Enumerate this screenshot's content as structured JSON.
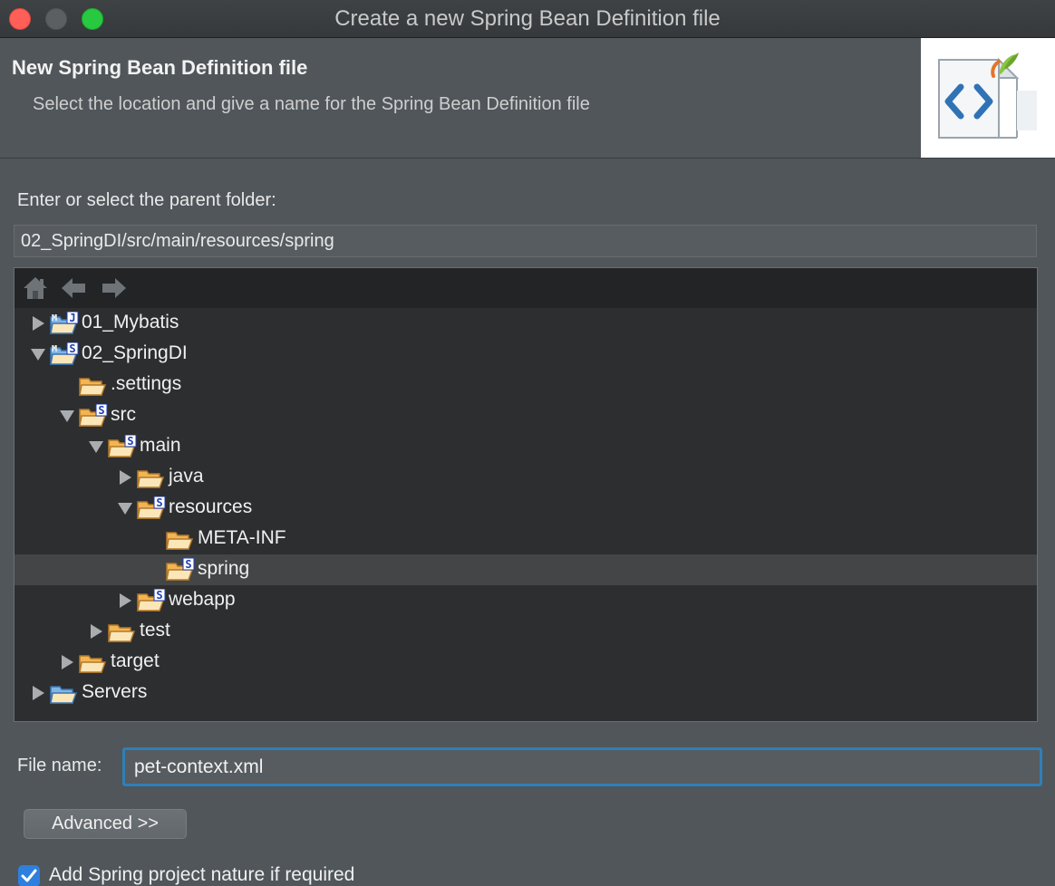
{
  "window": {
    "title": "Create a new Spring Bean Definition file"
  },
  "header": {
    "title": "New Spring Bean Definition file",
    "description": "Select the location and give a name for the Spring Bean Definition file",
    "image_icon": "spring-xml-file-icon"
  },
  "parent_folder": {
    "label": "Enter or select the parent folder:",
    "value": "02_SpringDI/src/main/resources/spring"
  },
  "tree": {
    "toolbar": [
      "home-icon",
      "back-arrow-icon",
      "forward-arrow-icon"
    ],
    "items": [
      {
        "label": "01_Mybatis",
        "depth": 0,
        "twisty": "collapsed",
        "icon": "project-folder-icon",
        "badge": "MJ",
        "selected": false
      },
      {
        "label": "02_SpringDI",
        "depth": 0,
        "twisty": "expanded",
        "icon": "project-folder-icon",
        "badge": "MS",
        "selected": false
      },
      {
        "label": ".settings",
        "depth": 1,
        "twisty": "none",
        "icon": "folder-icon",
        "badge": "",
        "selected": false
      },
      {
        "label": "src",
        "depth": 1,
        "twisty": "expanded",
        "icon": "folder-icon",
        "badge": "S",
        "selected": false
      },
      {
        "label": "main",
        "depth": 2,
        "twisty": "expanded",
        "icon": "folder-icon",
        "badge": "S",
        "selected": false
      },
      {
        "label": "java",
        "depth": 3,
        "twisty": "collapsed",
        "icon": "folder-icon",
        "badge": "",
        "selected": false
      },
      {
        "label": "resources",
        "depth": 3,
        "twisty": "expanded",
        "icon": "folder-icon",
        "badge": "S",
        "selected": false
      },
      {
        "label": "META-INF",
        "depth": 4,
        "twisty": "none",
        "icon": "folder-icon",
        "badge": "",
        "selected": false
      },
      {
        "label": "spring",
        "depth": 4,
        "twisty": "none",
        "icon": "folder-icon",
        "badge": "S",
        "selected": true
      },
      {
        "label": "webapp",
        "depth": 3,
        "twisty": "collapsed",
        "icon": "folder-icon",
        "badge": "S",
        "selected": false
      },
      {
        "label": "test",
        "depth": 2,
        "twisty": "collapsed",
        "icon": "folder-icon",
        "badge": "",
        "selected": false
      },
      {
        "label": "target",
        "depth": 1,
        "twisty": "collapsed",
        "icon": "folder-icon",
        "badge": "",
        "selected": false
      },
      {
        "label": "Servers",
        "depth": 0,
        "twisty": "collapsed",
        "icon": "project-folder-icon",
        "badge": "",
        "selected": false
      }
    ]
  },
  "file_name": {
    "label": "File name:",
    "value": "pet-context.xml"
  },
  "advanced": {
    "label": "Advanced >>"
  },
  "nature_checkbox": {
    "label": "Add Spring project nature if required",
    "checked": true
  },
  "colors": {
    "accent": "#2f7fb8",
    "selection": "#434547",
    "folder": "#f2b552"
  }
}
